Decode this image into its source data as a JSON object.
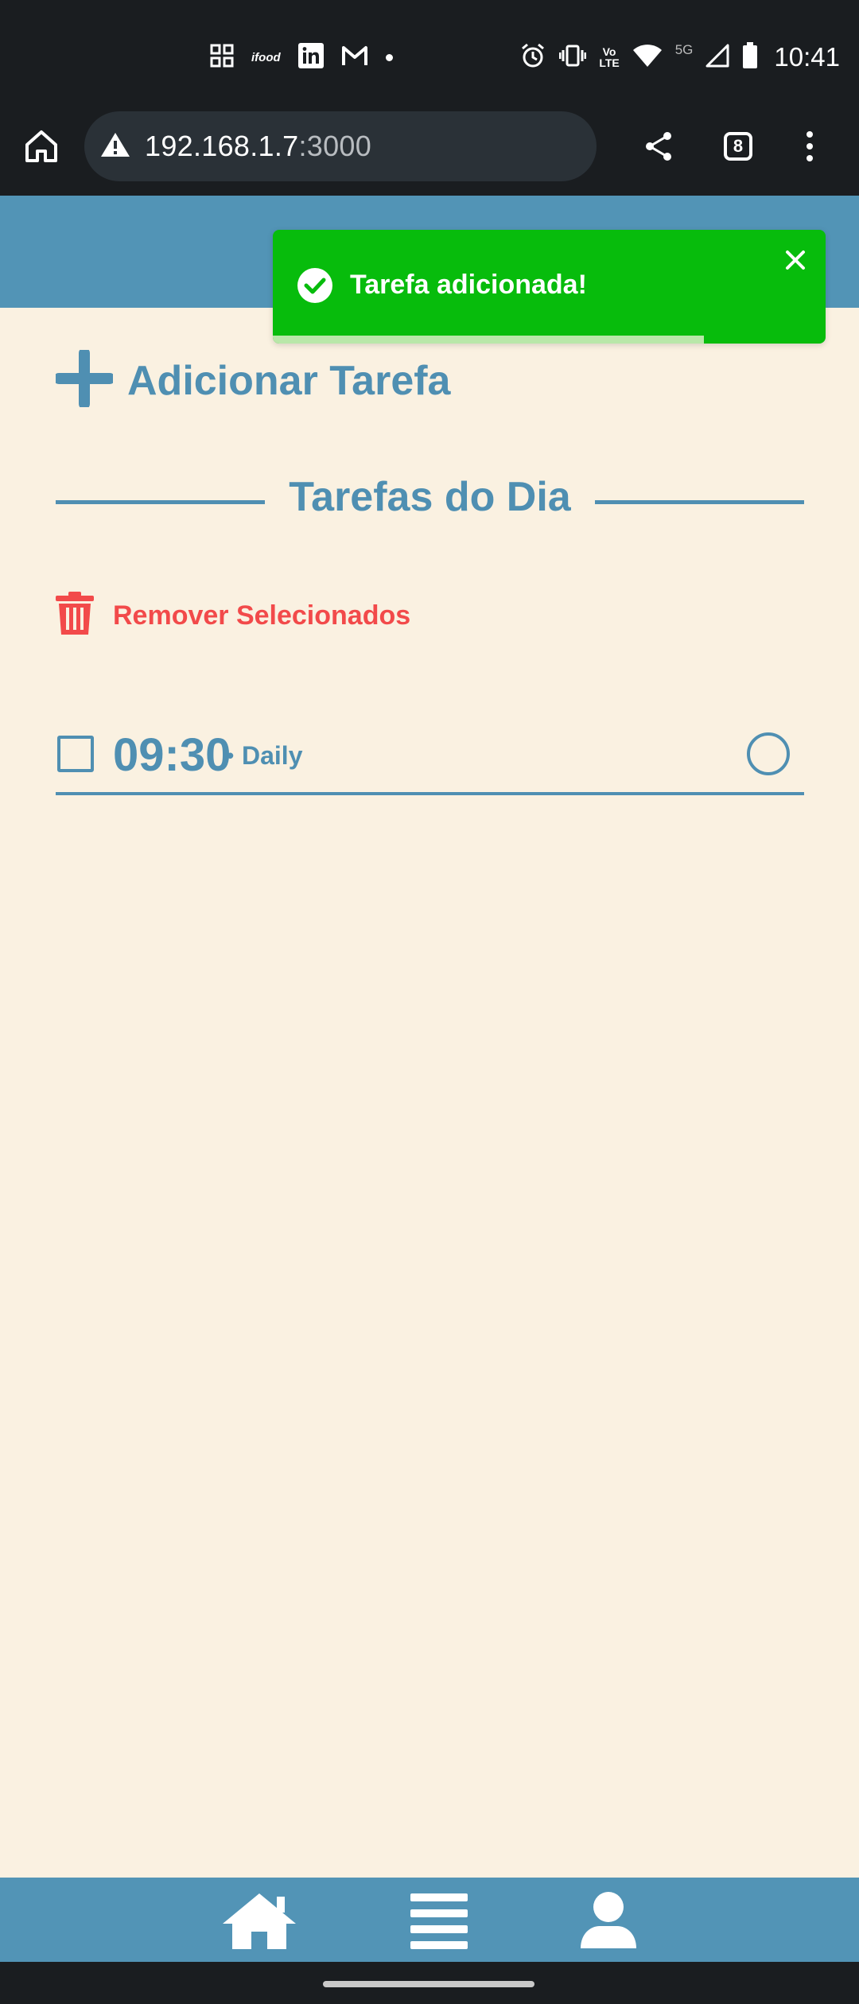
{
  "status_bar": {
    "time": "10:41",
    "left_icons": [
      "grid-app-icon",
      "ifood-icon",
      "linkedin-icon",
      "gmail-icon",
      "notification-dot"
    ],
    "ifood_text": "ifood",
    "network_tag": "5G",
    "lte_label_top": "Vo",
    "lte_label_bottom": "LTE"
  },
  "browser": {
    "url_host": "192.168.1.7",
    "url_port": ":3000",
    "tab_count": "8"
  },
  "toast": {
    "message": "Tarefa adicionada!",
    "progress": 0.78,
    "color": "#07bc0c"
  },
  "main": {
    "add_task_label": "Adicionar Tarefa",
    "section_title": "Tarefas do Dia",
    "remove_selected_label": "Remover Selecionados",
    "tasks": [
      {
        "time": "09:30",
        "separator": "•",
        "name": "Daily",
        "checked": false,
        "done": false
      }
    ]
  },
  "bottom_nav": {
    "items": [
      "home-icon",
      "list-icon",
      "user-icon"
    ]
  },
  "colors": {
    "accent": "#4f8fb2",
    "header": "#5294b6",
    "background": "#faf1e1",
    "danger": "#f24a4a"
  }
}
